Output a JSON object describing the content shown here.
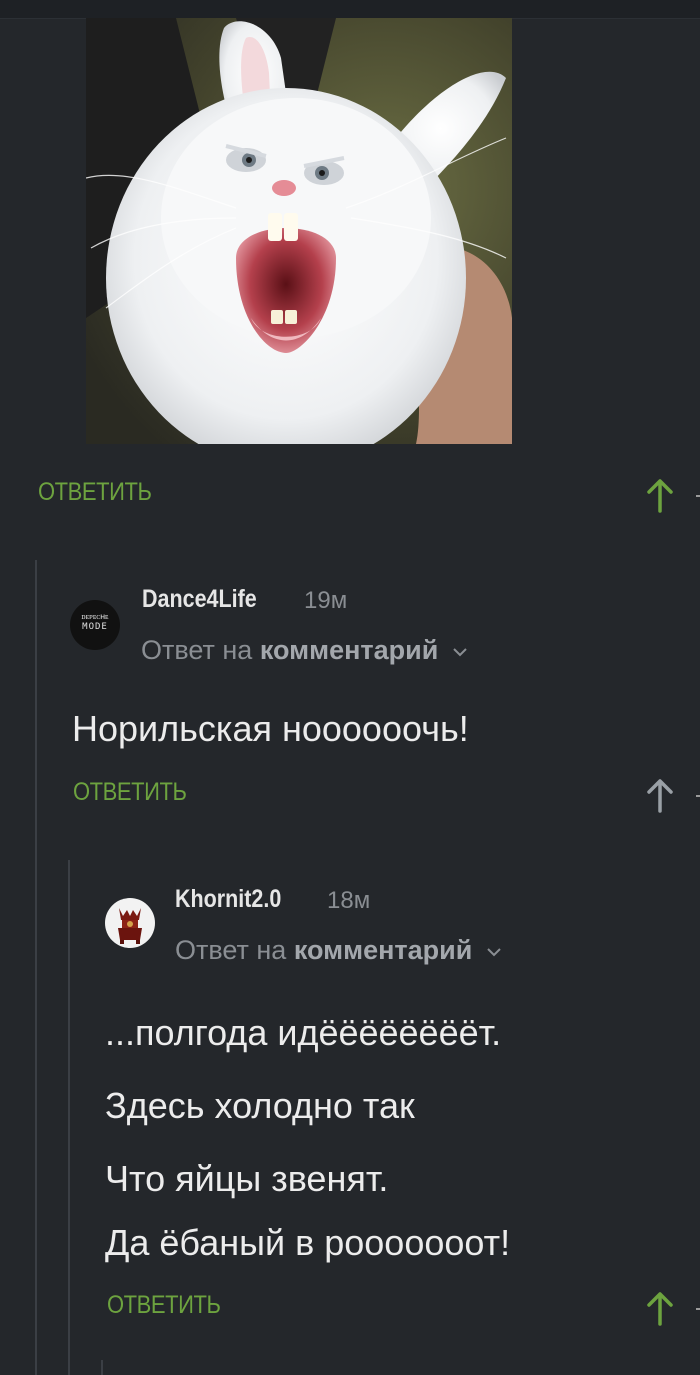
{
  "actions": {
    "reply_label": "ОТВЕТИТЬ"
  },
  "comments": [
    {
      "author": "Dance4Life",
      "time": "19м",
      "reply_prefix": "Ответ на",
      "reply_target": "комментарий",
      "avatar_text_line1": "ᴅᴇᴘᴇᴄʜᴇ",
      "avatar_text_line2": "MODE",
      "lines": [
        "Норильская ноооооочь!"
      ]
    },
    {
      "author": "Khornit2.0",
      "time": "18м",
      "reply_prefix": "Ответ на",
      "reply_target": "комментарий",
      "lines": [
        "...полгода идёёёёёёёёт.",
        "Здесь холодно так",
        "Что яйцы звенят.",
        "Да ёбаный в рооооооот!"
      ]
    }
  ],
  "colors": {
    "background": "#24272b",
    "accent_green": "#6da33f",
    "muted_text": "#8a8e93"
  },
  "icons": {
    "upvote": "up-arrow-icon",
    "expand": "chevron-down-icon"
  }
}
